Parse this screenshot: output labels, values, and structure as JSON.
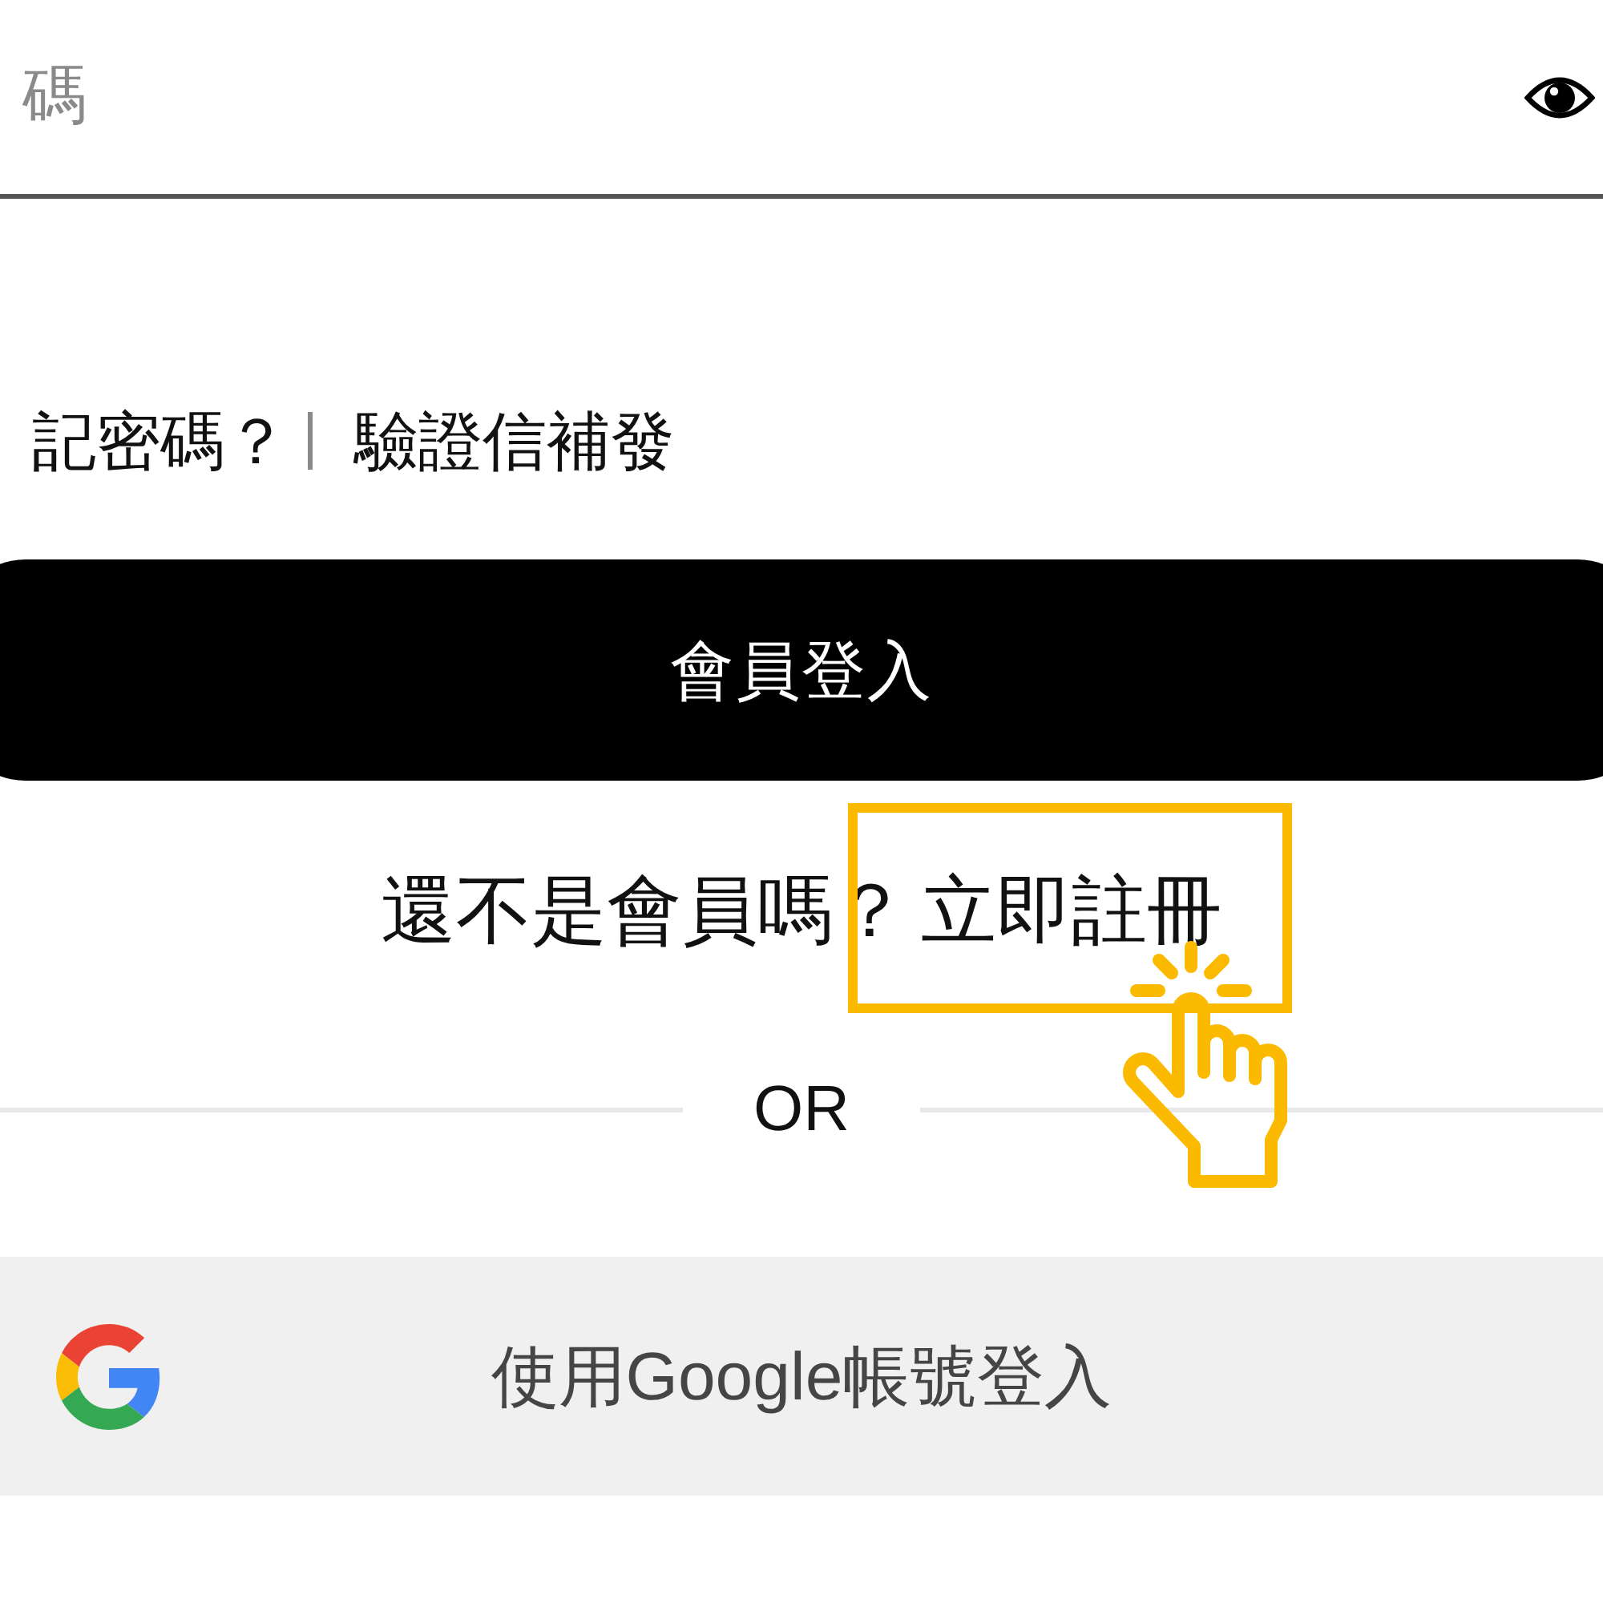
{
  "password_field": {
    "placeholder": "碼"
  },
  "links": [
    {
      "label": "記密碼？"
    },
    {
      "label": "驗證信補發"
    }
  ],
  "login_button": {
    "label": "會員登入"
  },
  "register_prompt": {
    "text": "還不是會員嗎？",
    "link": "立即註冊",
    "highlighted": true
  },
  "divider": {
    "label": "OR"
  },
  "google_button": {
    "label": "使用Google帳號登入"
  }
}
